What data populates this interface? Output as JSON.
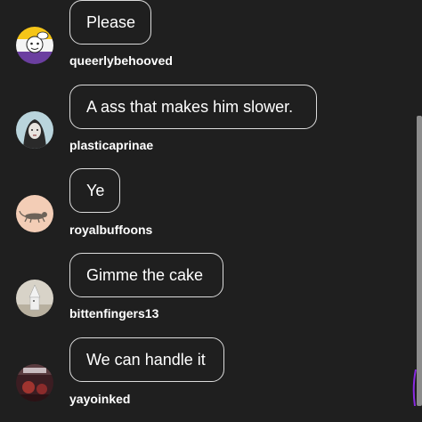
{
  "replies": [
    {
      "text": "Please",
      "username": "queerlybehooved",
      "avatar": "cartoon-avatar-icon"
    },
    {
      "text": "A ass that makes him slower.",
      "username": "plasticaprinae",
      "avatar": "portrait-avatar-icon"
    },
    {
      "text": "Ye",
      "username": "royalbuffoons",
      "avatar": "animal-avatar-icon"
    },
    {
      "text": "Gimme the cake",
      "username": "bittenfingers13",
      "avatar": "figure-avatar-icon"
    },
    {
      "text": "We can handle it",
      "username": "yayoinked",
      "avatar": "photo-avatar-icon"
    }
  ],
  "colors": {
    "background": "#1f1f1f",
    "bubble_border": "#dcdcdc",
    "text": "#ffffff",
    "scrollbar_thumb": "#8c8c8c",
    "accent": "#8a2be2"
  }
}
